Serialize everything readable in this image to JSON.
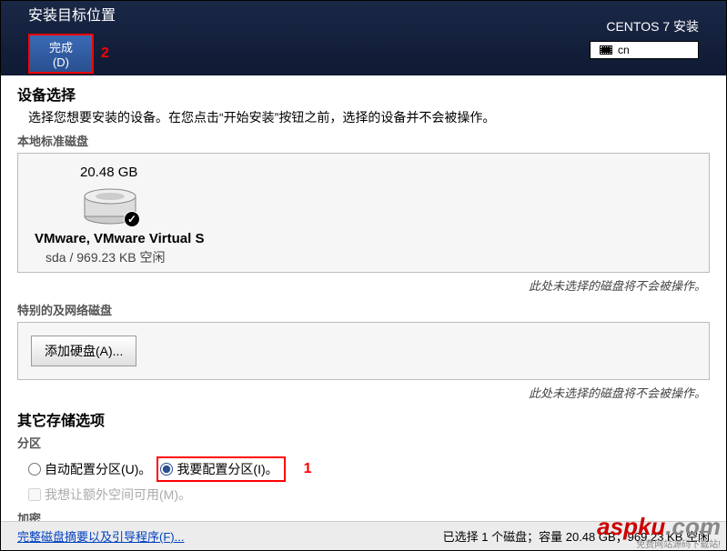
{
  "header": {
    "title": "安装目标位置",
    "done_btn": "完成(D)",
    "annot2": "2",
    "product": "CENTOS 7 安装",
    "lang": "cn"
  },
  "device": {
    "heading": "设备选择",
    "desc": "选择您想要安装的设备。在您点击“开始安装”按钮之前，选择的设备并不会被操作。",
    "local_h": "本地标准磁盘",
    "disk": {
      "size": "20.48 GB",
      "name": "VMware, VMware Virtual S",
      "free_line": "sda    /    969.23 KB 空闲"
    },
    "hint": "此处未选择的磁盘将不会被操作。",
    "special_h": "特别的及网络磁盘",
    "add_btn": "添加硬盘(A)...",
    "hint2": "此处未选择的磁盘将不会被操作。"
  },
  "storage": {
    "heading": "其它存储选项",
    "part_h": "分区",
    "auto": "自动配置分区(U)。",
    "manual": "我要配置分区(I)。",
    "annot1": "1",
    "extra_space": "我想让额外空间可用(M)。",
    "encrypt_h": "加密"
  },
  "footer": {
    "link": "完整磁盘摘要以及引导程序(F)...",
    "status": "已选择 1 个磁盘；容量 20.48 GB；969.23 KB 空闲"
  },
  "watermark": {
    "main": "aspku",
    "suffix": ".com",
    "sub": "免费网站源码下载站!"
  }
}
